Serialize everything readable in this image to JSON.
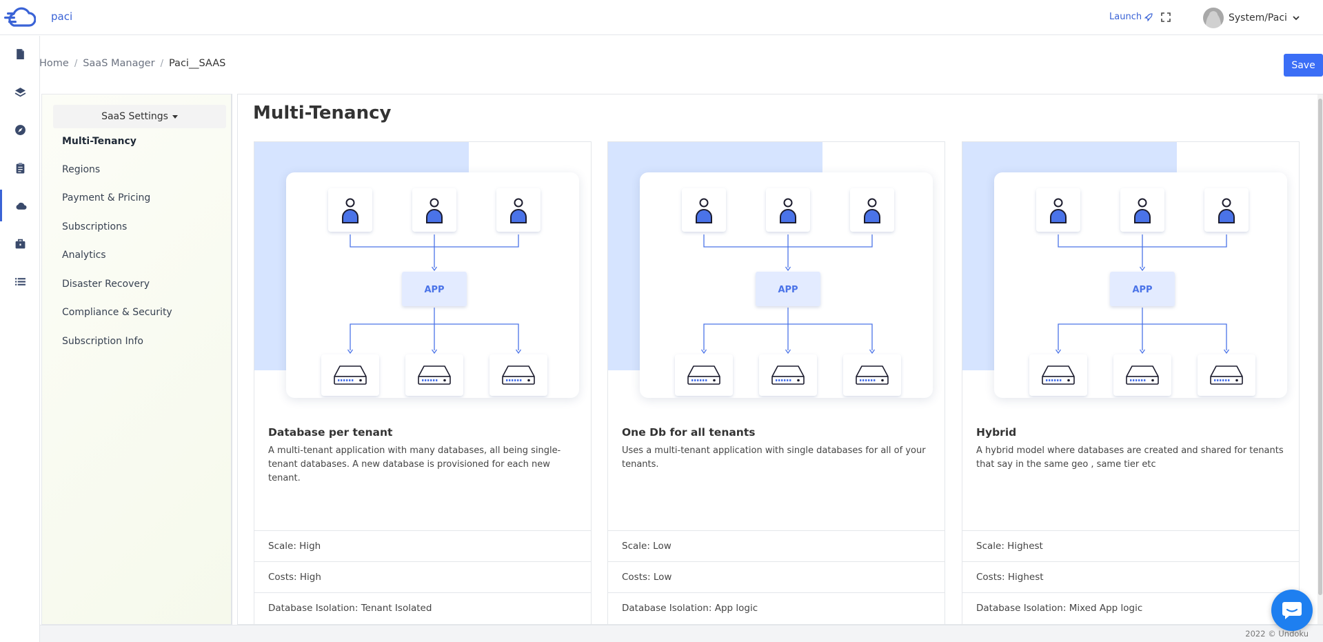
{
  "app": {
    "name": "paci",
    "brand_color": "#3a63d6"
  },
  "topbar": {
    "launch_label": "Launch",
    "user_label": "System/Paci"
  },
  "rail": {
    "items": [
      {
        "icon": "document-icon"
      },
      {
        "icon": "layers-icon"
      },
      {
        "icon": "compass-icon"
      },
      {
        "icon": "clipboard-icon"
      },
      {
        "icon": "cloud-icon",
        "active": true
      },
      {
        "icon": "briefcase-icon"
      },
      {
        "icon": "list-icon"
      }
    ]
  },
  "breadcrumb": {
    "items": [
      "Home",
      "SaaS Manager",
      "Paci__SAAS"
    ],
    "separator": "/"
  },
  "save_label": "Save",
  "settings": {
    "dropdown_label": "SaaS Settings",
    "items": [
      "Multi-Tenancy",
      "Regions",
      "Payment & Pricing",
      "Subscriptions",
      "Analytics",
      "Disaster Recovery",
      "Compliance & Security",
      "Subscription Info"
    ],
    "active_index": 0
  },
  "page_title": "Multi-Tenancy",
  "diagram": {
    "app_label": "APP"
  },
  "cards": [
    {
      "title": "Database per tenant",
      "description": "A multi-tenant application with many databases, all being single-tenant databases. A new database is provisioned for each new tenant.",
      "scale": "Scale: High",
      "costs": "Costs: High",
      "isolation": "Database Isolation: Tenant Isolated"
    },
    {
      "title": "One Db for all tenants",
      "description": "Uses a multi-tenant application with single databases for all of your tenants.",
      "scale": "Scale: Low",
      "costs": "Costs: Low",
      "isolation": "Database Isolation: App logic"
    },
    {
      "title": "Hybrid",
      "description": "A hybrid model where databases are created and shared for tenants that say in the same geo , same tier etc",
      "scale": "Scale: Highest",
      "costs": "Costs: Highest",
      "isolation": "Database Isolation: Mixed App logic"
    }
  ],
  "footer": {
    "text": "2022 © Undoku"
  },
  "colors": {
    "accent": "#3b6ef6",
    "illustration_bg": "#d6e4ff",
    "chat": "#1e7ff0"
  }
}
